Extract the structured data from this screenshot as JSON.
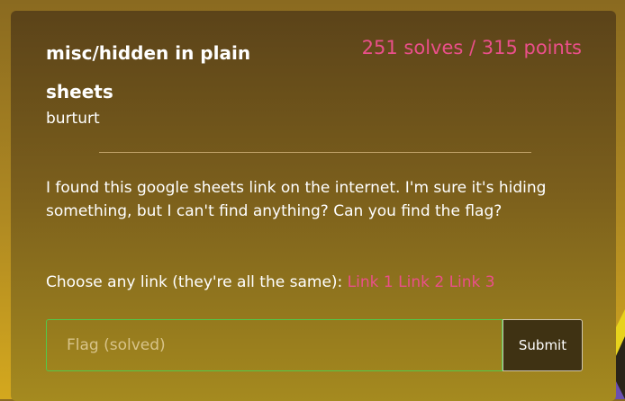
{
  "challenge": {
    "title": "misc/hidden in plain sheets",
    "solves_points": "251 solves / 315 points",
    "author": "burturt",
    "description": "I found this google sheets link on the internet. I'm sure it's hiding something, but I can't find anything? Can you find the flag?",
    "links_prompt": "Choose any link (they're all the same):",
    "links": [
      "Link 1",
      "Link 2",
      "Link 3"
    ]
  },
  "form": {
    "flag_placeholder": "Flag (solved)",
    "submit_label": "Submit"
  },
  "colors": {
    "accent": "#ea4f8a",
    "input_border": "#52c94a"
  }
}
